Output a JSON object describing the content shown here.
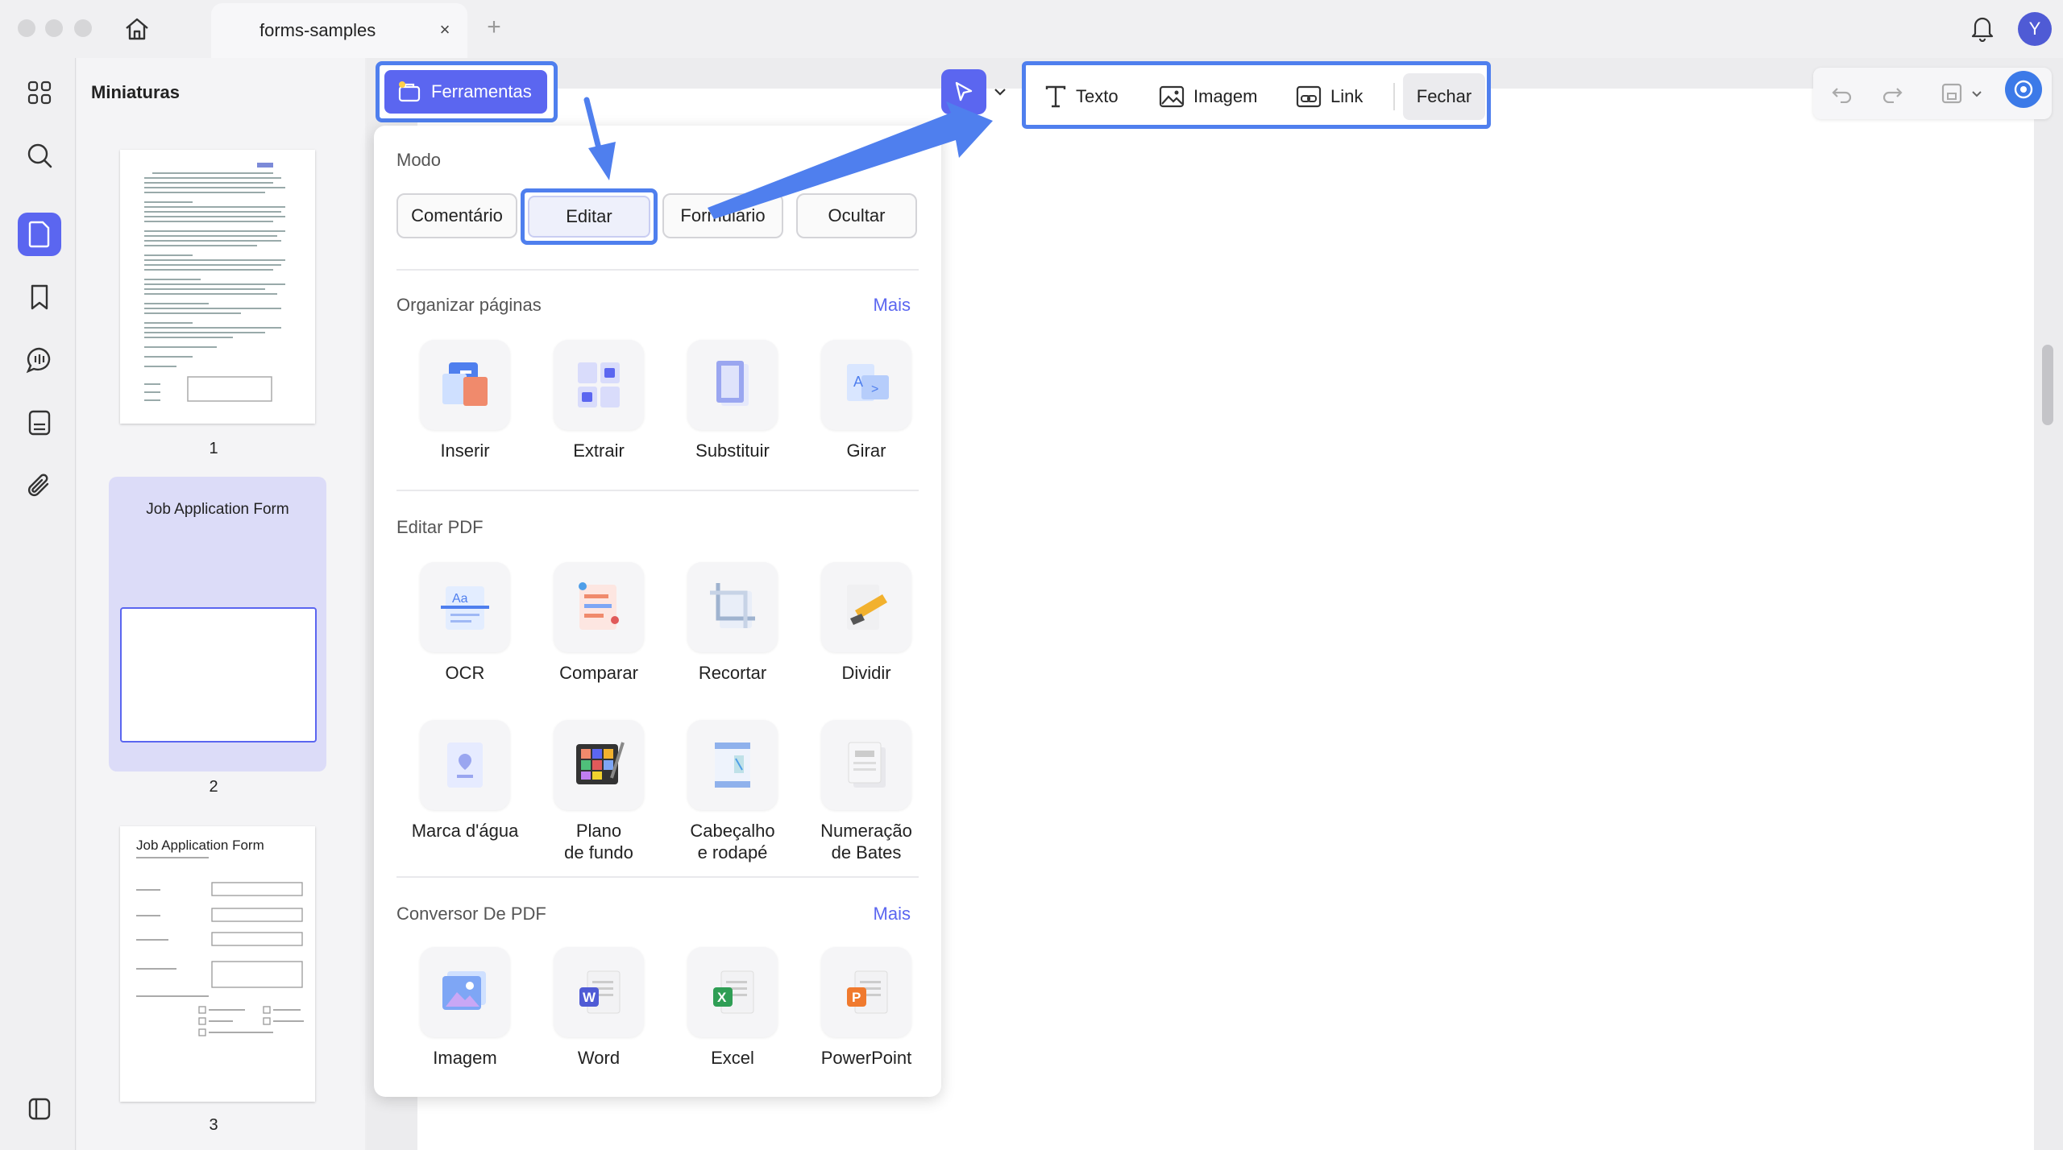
{
  "tab": {
    "title": "forms-samples",
    "close": "×",
    "add": "+"
  },
  "user": {
    "initial": "Y"
  },
  "thumbnails": {
    "title": "Miniaturas",
    "pages": [
      {
        "number": "1"
      },
      {
        "number": "2",
        "heading": "Job Application Form"
      },
      {
        "number": "3",
        "heading": "Job Application Form"
      }
    ]
  },
  "toolbar": {
    "ferramentas": "Ferramentas",
    "texto": "Texto",
    "imagem": "Imagem",
    "link": "Link",
    "fechar": "Fechar"
  },
  "panel": {
    "modo": {
      "title": "Modo",
      "buttons": [
        "Comentário",
        "Editar",
        "Formulário",
        "Ocultar"
      ]
    },
    "organizar": {
      "title": "Organizar páginas",
      "more": "Mais",
      "tools": [
        "Inserir",
        "Extrair",
        "Substituir",
        "Girar"
      ]
    },
    "editar_pdf": {
      "title": "Editar PDF",
      "tools": [
        "OCR",
        "Comparar",
        "Recortar",
        "Dividir"
      ],
      "tools2": [
        {
          "line1": "Marca d'água",
          "line2": ""
        },
        {
          "line1": "Plano",
          "line2": "de fundo"
        },
        {
          "line1": "Cabeçalho",
          "line2": "e rodapé"
        },
        {
          "line1": "Numeração",
          "line2": "de Bates"
        }
      ]
    },
    "conversor": {
      "title": "Conversor De PDF",
      "more": "Mais",
      "tools": [
        "Imagem",
        "Word",
        "Excel",
        "PowerPoint"
      ]
    }
  },
  "colors": {
    "accent": "#5b66f0",
    "highlight": "#4f7fee"
  }
}
